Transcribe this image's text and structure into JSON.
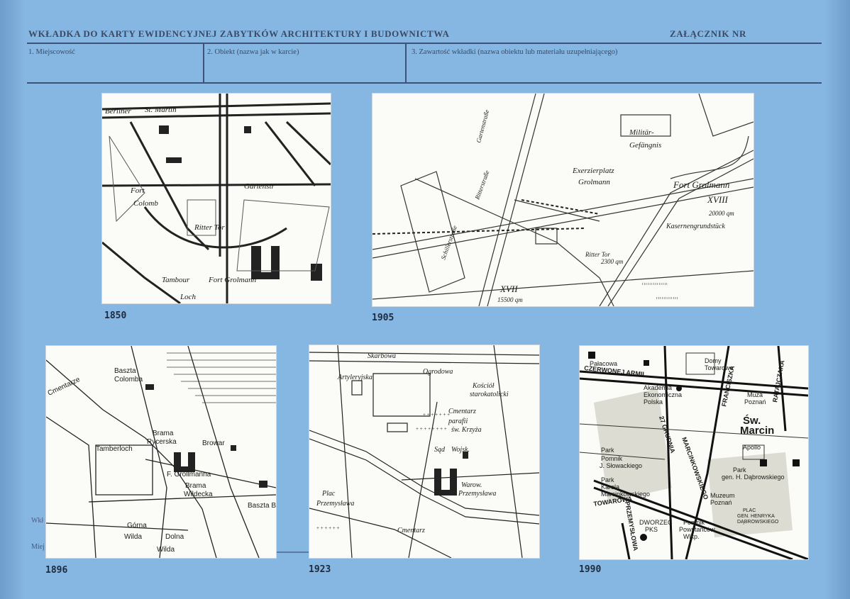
{
  "header": {
    "title": "WKŁADKA DO KARTY EWIDENCYJNEJ ZABYTKÓW ARCHITEKTURY I BUDOWNICTWA",
    "attachment": "ZAŁĄCZNIK NR",
    "field1": "1. Miejscowość",
    "field2": "2. Obiekt (nazwa jak w karcie)",
    "field3": "3. Zawartość wkładki (nazwa obiektu lub materiału uzupełniającego)"
  },
  "ghost_labels": {
    "left1": "Wkł",
    "left2": "Miej"
  },
  "maps": [
    {
      "year": "1850",
      "labels": [
        "Berliner",
        "St. Martin",
        "Fort",
        "Colomb",
        "Ritter Tor",
        "Tambour",
        "Fort Grolmann",
        "Loch",
        "Gärtenstr"
      ]
    },
    {
      "year": "1905",
      "labels": [
        "Militär-",
        "Gefängnis",
        "Exerzierplatz",
        "Grolmann",
        "Fort Grolmann",
        "XVIII",
        "20000 qm",
        "Kasernengrundstück",
        "Ritter Tor",
        "2300 qm",
        "XVII",
        "15500 qm",
        "Gartenstraße",
        "Ritterstraße",
        "Schillerstraße"
      ]
    },
    {
      "year": "1896",
      "labels": [
        "Baszta",
        "Colomba",
        "Cmentarze",
        "Tamberloch",
        "Brama",
        "Rycerska",
        "Browar",
        "F. Grollmanna",
        "Brama",
        "Wildecka",
        "Baszta Br",
        "Górna",
        "Wilda",
        "Dolna",
        "Wilda"
      ]
    },
    {
      "year": "1923",
      "labels": [
        "Skarbowa",
        "Artyleryjska",
        "Ogrodowa",
        "Kościół",
        "starokatolicki",
        "Cmentarz",
        "parafii",
        "św. Krzyża",
        "Sąd",
        "Wojsk.",
        "Warow.",
        "Przemysława",
        "Plac",
        "Przemysława",
        "Cmentarz"
      ]
    },
    {
      "year": "1990",
      "labels": [
        "Pałacowa",
        "Akademia",
        "Ekonomiczna",
        "Polska",
        "Domy",
        "Towarowe",
        "Muza",
        "Poznań",
        "Św.",
        "Marcin",
        "Apollo",
        "Park",
        "Pomnik",
        "J. Słowackiego",
        "Park",
        "Karola",
        "Marcinkowskiego",
        "Park",
        "gen. H. Dąbrowskiego",
        "Muzeum",
        "Poznań",
        "DWORZEC",
        "PKS",
        "Pomnik",
        "Powstańców",
        "Wlkp.",
        "TOWAROWA",
        "PRZEMYSŁOWA",
        "27 GRUDNIA",
        "FRANCISZKA",
        "RATAJCZAKA",
        "MARCINKOWSKIEGO",
        "PLAC",
        "GEN. HENRYKA",
        "DĄBROWSKIEGO",
        "CZERWONEJ ARMII"
      ]
    }
  ]
}
